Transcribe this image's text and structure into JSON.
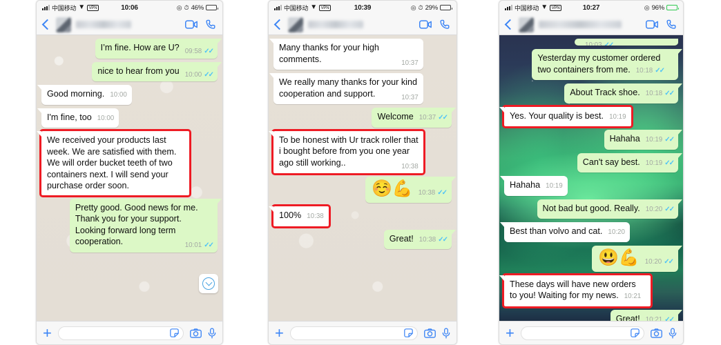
{
  "app": {
    "name": "WhatsApp"
  },
  "colors": {
    "outgoing_bubble": "#dcf8c6",
    "incoming_bubble": "#ffffff",
    "accent_blue": "#3b84f5",
    "tick_blue": "#4fc3f7",
    "annotation_red": "#ee1b24",
    "doodle_background": "#e3ddd4"
  },
  "icons": {
    "back": "chevron-left-icon",
    "video": "video-camera-icon",
    "call": "phone-icon",
    "plus": "plus-icon",
    "sticker": "sticker-icon",
    "camera": "camera-icon",
    "mic": "microphone-icon",
    "scroll_down": "chevron-down-icon",
    "wifi": "wifi-icon",
    "vpn": "vpn-badge-icon",
    "location": "location-arrow-icon",
    "alarm": "alarm-clock-icon",
    "signal": "signal-bars-icon",
    "battery": "battery-icon",
    "read_ticks": "double-check-icon"
  },
  "phones": [
    {
      "id": "phone-1",
      "wallpaper": "doodle",
      "status": {
        "carrier": "中国移动",
        "wifi": "▼",
        "vpn": "VPN",
        "time": "10:06",
        "location": "◎",
        "alarm": "⏱",
        "battery_pct": "46%",
        "battery_level": 46,
        "battery_green": false
      },
      "contact_name_blurred": true,
      "messages": [
        {
          "dir": "out",
          "text": "I’m fine. How are U?",
          "time": "09:58",
          "ticks": true,
          "marked": false,
          "meta_inline": false
        },
        {
          "dir": "out",
          "text": "nice to hear from you",
          "time": "10:00",
          "ticks": true,
          "marked": false,
          "meta_inline": false
        },
        {
          "dir": "in",
          "text": "Good morning.",
          "time": "10:00",
          "ticks": false,
          "marked": false,
          "meta_inline": true
        },
        {
          "dir": "in",
          "text": "I'm fine, too",
          "time": "10:00",
          "ticks": false,
          "marked": false,
          "meta_inline": true
        },
        {
          "dir": "in",
          "text": "We received your products last week. We are satisfied with them. We will order bucket teeth of two containers next. I will send your purchase order soon.",
          "time": "",
          "ticks": false,
          "marked": true,
          "meta_inline": false
        },
        {
          "dir": "out",
          "text": "Pretty good. Good news for me. Thank you for your support. Looking forward long term cooperation.",
          "time": "10:01",
          "ticks": true,
          "marked": false,
          "meta_inline": false
        }
      ],
      "scroll_button": true,
      "input": {
        "value": "",
        "placeholder": ""
      }
    },
    {
      "id": "phone-2",
      "wallpaper": "doodle",
      "status": {
        "carrier": "中国移动",
        "wifi": "▼",
        "vpn": "VPN",
        "time": "10:39",
        "location": "◎",
        "alarm": "⏱",
        "battery_pct": "29%",
        "battery_level": 29,
        "battery_green": false
      },
      "contact_name_blurred": true,
      "messages": [
        {
          "dir": "in",
          "text": "Many thanks for your high comments.",
          "time": "10:37",
          "ticks": false,
          "marked": false,
          "meta_inline": false
        },
        {
          "dir": "in",
          "text": "We really many thanks for your kind cooperation and support.",
          "time": "10:37",
          "ticks": false,
          "marked": false,
          "meta_inline": false
        },
        {
          "dir": "out",
          "text": "Welcome",
          "time": "10:37",
          "ticks": true,
          "marked": false,
          "meta_inline": true
        },
        {
          "dir": "in",
          "text": "To be honest with Ur track roller that i bought before from you one year ago still working..",
          "time": "10:38",
          "ticks": false,
          "marked": true,
          "meta_inline": false
        },
        {
          "dir": "out",
          "text": "☺️💪",
          "time": "10:38",
          "ticks": true,
          "marked": false,
          "meta_inline": false,
          "emoji": true
        },
        {
          "dir": "in",
          "text": "100%",
          "time": "10:38",
          "ticks": false,
          "marked": true,
          "meta_inline": true
        },
        {
          "dir": "out",
          "text": "Great!",
          "time": "10:38",
          "ticks": true,
          "marked": false,
          "meta_inline": true
        }
      ],
      "scroll_button": false,
      "input": {
        "value": "",
        "placeholder": ""
      }
    },
    {
      "id": "phone-3",
      "wallpaper": "aurora",
      "status": {
        "carrier": "中国移动",
        "wifi": "▼",
        "vpn": "VPN",
        "time": "10:27",
        "location": "◎",
        "alarm": "",
        "battery_pct": "96%",
        "battery_level": 96,
        "battery_green": true
      },
      "contact_name_blurred": true,
      "messages": [
        {
          "dir": "out",
          "text": "",
          "time": "10:03",
          "ticks": true,
          "marked": false,
          "meta_inline": true,
          "clipped": true
        },
        {
          "dir": "out",
          "text": "Yesterday my customer ordered two containers from me.",
          "time": "10:18",
          "ticks": true,
          "marked": false,
          "meta_inline": true
        },
        {
          "dir": "out",
          "text": "About Track shoe.",
          "time": "10:18",
          "ticks": true,
          "marked": false,
          "meta_inline": true
        },
        {
          "dir": "in",
          "text": "Yes. Your quality is best.",
          "time": "10:19",
          "ticks": false,
          "marked": true,
          "meta_inline": true
        },
        {
          "dir": "out",
          "text": "Hahaha",
          "time": "10:19",
          "ticks": true,
          "marked": false,
          "meta_inline": true
        },
        {
          "dir": "out",
          "text": "Can't say best.",
          "time": "10:19",
          "ticks": true,
          "marked": false,
          "meta_inline": true
        },
        {
          "dir": "in",
          "text": "Hahaha",
          "time": "10:19",
          "ticks": false,
          "marked": false,
          "meta_inline": true
        },
        {
          "dir": "out",
          "text": "Not bad but good. Really.",
          "time": "10:20",
          "ticks": true,
          "marked": false,
          "meta_inline": true
        },
        {
          "dir": "in",
          "text": "Best than volvo and cat.",
          "time": "10:20",
          "ticks": false,
          "marked": false,
          "meta_inline": true
        },
        {
          "dir": "out",
          "text": "😃💪",
          "time": "10:20",
          "ticks": true,
          "marked": false,
          "meta_inline": false,
          "emoji": true
        },
        {
          "dir": "in",
          "text": "These days will have new orders to you! Waiting for my news.",
          "time": "10:21",
          "ticks": false,
          "marked": true,
          "meta_inline": true
        },
        {
          "dir": "out",
          "text": "Great!",
          "time": "10:21",
          "ticks": true,
          "marked": false,
          "meta_inline": true
        }
      ],
      "scroll_button": false,
      "input": {
        "value": "",
        "placeholder": ""
      }
    }
  ]
}
